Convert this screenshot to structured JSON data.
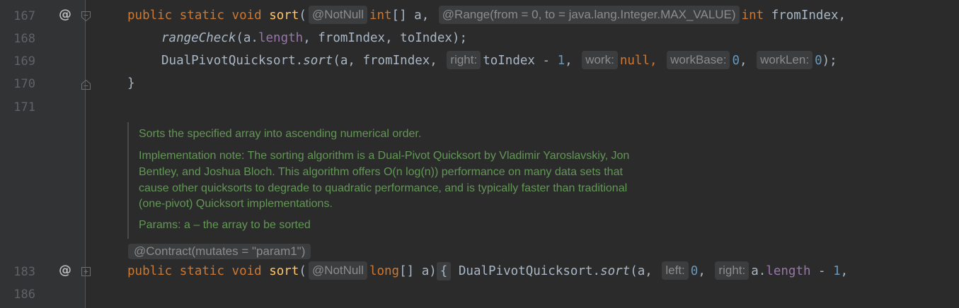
{
  "lines": {
    "l167": "167",
    "l168": "168",
    "l169": "169",
    "l170": "170",
    "l171": "171",
    "l183": "183",
    "l186": "186"
  },
  "gutter": {
    "override_marker": "@"
  },
  "code": {
    "l167": {
      "kw_public": "public",
      "kw_static": "static",
      "kw_void": "void",
      "name": "sort",
      "paren": "(",
      "hint_notnull": "@NotNull",
      "type": "int",
      "arr": "[] a,",
      "hint_range": "@Range(from = 0, to = java.lang.Integer.MAX_VALUE)",
      "type2": "int",
      "param2": "fromIndex,"
    },
    "l168": {
      "method": "rangeCheck",
      "open": "(a.",
      "field": "length",
      "rest": ", fromIndex, toIndex);"
    },
    "l169": {
      "cls": "DualPivotQuicksort.",
      "method": "sort",
      "args": "(a, fromIndex,",
      "hint_right": "right:",
      "expr": "toIndex - ",
      "one": "1",
      "comma1": ",",
      "hint_work": "work:",
      "null_kw": "null,",
      "hint_workbase": "workBase:",
      "zero1": "0",
      "comma2": ",",
      "hint_worklen": "workLen:",
      "zero2": "0",
      "close": ");"
    },
    "l170": {
      "brace": "}"
    },
    "l183": {
      "kw_public": "public",
      "kw_static": "static",
      "kw_void": "void",
      "name": "sort",
      "paren": "(",
      "hint_notnull": "@NotNull",
      "type": "long",
      "arr": "[] a)",
      "fold": "{",
      "cls": "DualPivotQuicksort.",
      "method": "sort",
      "args": "(a,",
      "hint_left": "left:",
      "zero": "0",
      "comma": ",",
      "hint_right": "right:",
      "a": "a.",
      "field": "length",
      "minus": " - ",
      "one": "1",
      "comma2": ","
    }
  },
  "javadoc": {
    "summary": "Sorts the specified array into ascending numerical order.",
    "note1": "Implementation note: The sorting algorithm is a Dual-Pivot Quicksort by Vladimir Yaroslavskiy, Jon",
    "note2": "Bentley, and Joshua Bloch. This algorithm offers O(n log(n)) performance on many data sets that",
    "note3": "cause other quicksorts to degrade to quadratic performance, and is typically faster than traditional",
    "note4": "(one-pivot) Quicksort implementations.",
    "params": "Params: a – the array to be sorted"
  },
  "contract": "@Contract(mutates = \"param1\")",
  "colors": {
    "background": "#2b2b2b",
    "gutter": "#313335",
    "keyword": "#cc7832",
    "function": "#ffc66d",
    "field": "#9876aa",
    "number": "#6897bb",
    "text": "#a9b7c6",
    "doc": "#629755",
    "hint": "#8c8c8c"
  },
  "icons": [
    "override-at-icon",
    "fold-collapse-icon",
    "fold-end-icon",
    "fold-expand-icon"
  ]
}
